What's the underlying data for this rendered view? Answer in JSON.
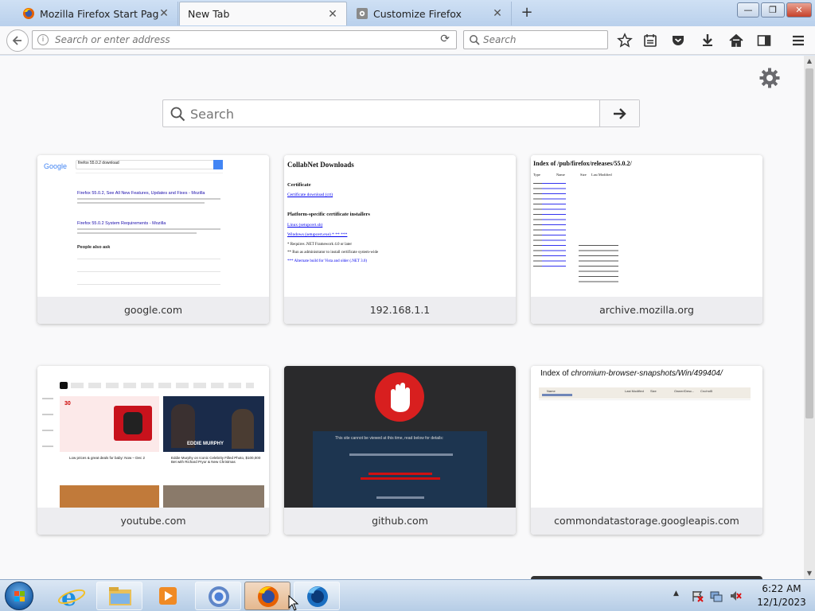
{
  "window": {
    "tabs": [
      {
        "label": "Mozilla Firefox Start Page",
        "active": false
      },
      {
        "label": "New Tab",
        "active": true
      },
      {
        "label": "Customize Firefox",
        "active": false
      }
    ],
    "new_tab_symbol": "+",
    "controls": {
      "minimize": "—",
      "maximize": "❐",
      "close": "✕"
    }
  },
  "navbar": {
    "url_placeholder": "Search or enter address",
    "search_placeholder": "Search",
    "icons": [
      "back-arrow-icon",
      "info-icon",
      "reload-icon",
      "bookmark-star-icon",
      "reader-list-icon",
      "pocket-icon",
      "download-icon",
      "home-icon",
      "sidebar-icon",
      "menu-icon"
    ]
  },
  "newtab": {
    "search_placeholder": "Search",
    "top_sites": [
      {
        "label": "google.com"
      },
      {
        "label": "192.168.1.1"
      },
      {
        "label": "archive.mozilla.org"
      },
      {
        "label": "youtube.com"
      },
      {
        "label": "github.com"
      },
      {
        "label": "commondatastorage.googleapis.com"
      }
    ]
  },
  "thumbnails": {
    "google": {
      "logo": "Google",
      "query": "firefox 55.0.2 download",
      "result1_title": "Firefox 55.0.2, See All New Features, Updates and Fixes - Mozilla",
      "result2_title": "Firefox 55.0.2 System Requirements - Mozilla",
      "people_also_ask": "People also ask"
    },
    "collabnet": {
      "title": "CollabNet Downloads",
      "section1": "Certificate",
      "link1": "Certificate download (crt)",
      "section2": "Platform-specific certificate installers",
      "link2": "Linux (setupcert.sh)",
      "link3": "Windows (setupcert.exe) * ** ***",
      "note1": "* Requires .NET Framework 4.0 or later",
      "note2": "** Run as administrator to install certificate system-wide",
      "note3": "*** Alternate build for Vista and older (.NET 3.0)"
    },
    "archive": {
      "title": "Index of /pub/firefox/releases/55.0.2/",
      "headers": [
        "Type",
        "Name",
        "Size",
        "Last Modified"
      ]
    },
    "youtube": {
      "promo_big": "30",
      "promo_text": "Up to\noff",
      "video_title": "EDDIE MURPHY",
      "caption1": "Low prices & great deals for baby: Now – Dec 2",
      "caption2": "Eddie Murphy on Iconic Celebrity Filled Photo, $100,000 Bet with Richard Pryor & New Christmas"
    },
    "github": {
      "message": "This site cannot be viewed at this time, read below for details:"
    },
    "chromium": {
      "title_prefix": "Index of ",
      "title_path": "chromium-browser-snapshots/Win/499404/",
      "headers": [
        "Name",
        "Last Modified",
        "Size",
        "Owner/Desc...",
        "Crc/md5"
      ]
    }
  },
  "taskbar": {
    "apps": [
      "internet-explorer",
      "file-explorer",
      "media-player",
      "chrome",
      "firefox",
      "firefox-developer"
    ],
    "time": "6:22 AM",
    "date": "12/1/2023"
  }
}
